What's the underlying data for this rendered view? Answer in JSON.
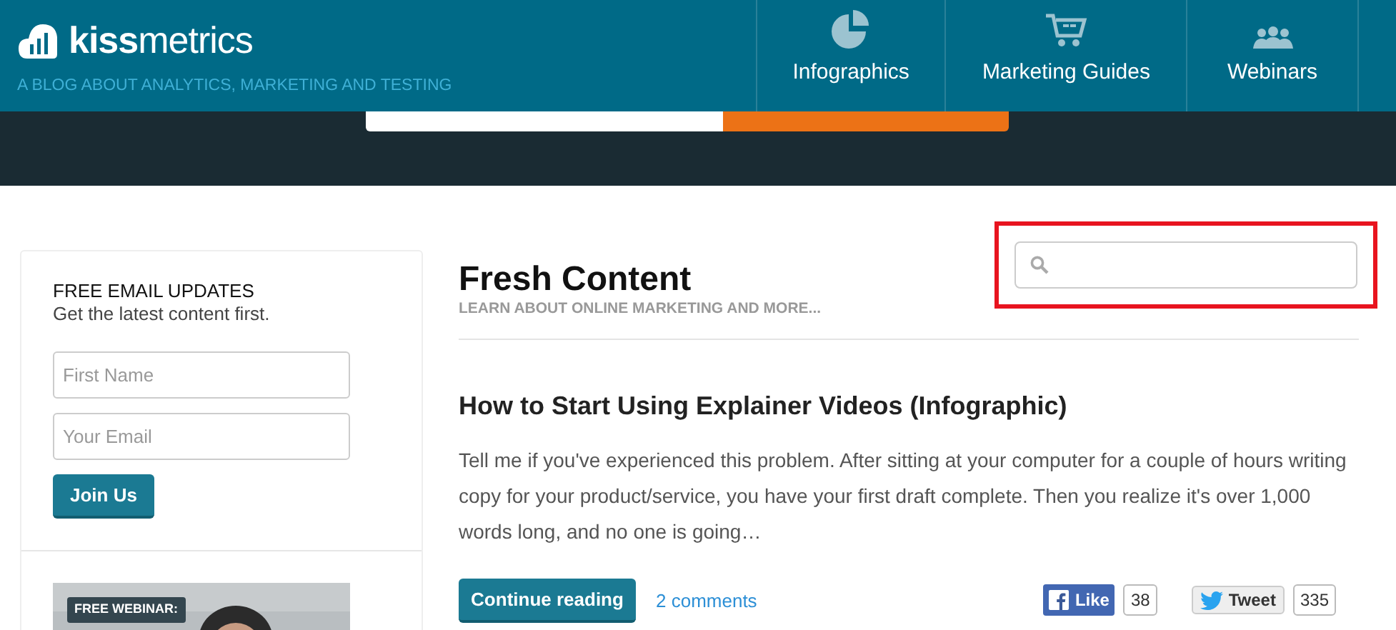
{
  "header": {
    "logo_text": {
      "bold": "kiss",
      "light": "metrics"
    },
    "tagline": "A BLOG ABOUT ANALYTICS, MARKETING AND TESTING",
    "nav": [
      {
        "kind": "pie",
        "label": "Infographics"
      },
      {
        "kind": "cart",
        "label": "Marketing Guides"
      },
      {
        "kind": "people",
        "label": "Webinars"
      }
    ]
  },
  "sidebar": {
    "title": "FREE EMAIL UPDATES",
    "subtitle": "Get the latest content first.",
    "fields": [
      {
        "placeholder": "First Name"
      },
      {
        "placeholder": "Your Email"
      }
    ],
    "button": "Join Us",
    "promo": {
      "kind": "picture",
      "badge": "FREE WEBINAR:"
    }
  },
  "main": {
    "title": "Fresh Content",
    "subtitle": "LEARN ABOUT ONLINE MARKETING AND MORE...",
    "search": {
      "highlighted": true
    },
    "post": {
      "title": "How to Start Using Explainer Videos (Infographic)",
      "excerpt": "Tell me if you've experienced this problem. After sitting at your computer for a couple of hours writing copy for your product/service, you have your first draft complete. Then you realize it's over 1,000 words long, and no one is going…",
      "button": "Continue reading",
      "comments": "2 comments",
      "social": [
        {
          "kind": "facebook",
          "label": "Like",
          "count": "38"
        },
        {
          "kind": "twitter",
          "label": "Tweet",
          "count": "335"
        }
      ]
    }
  }
}
